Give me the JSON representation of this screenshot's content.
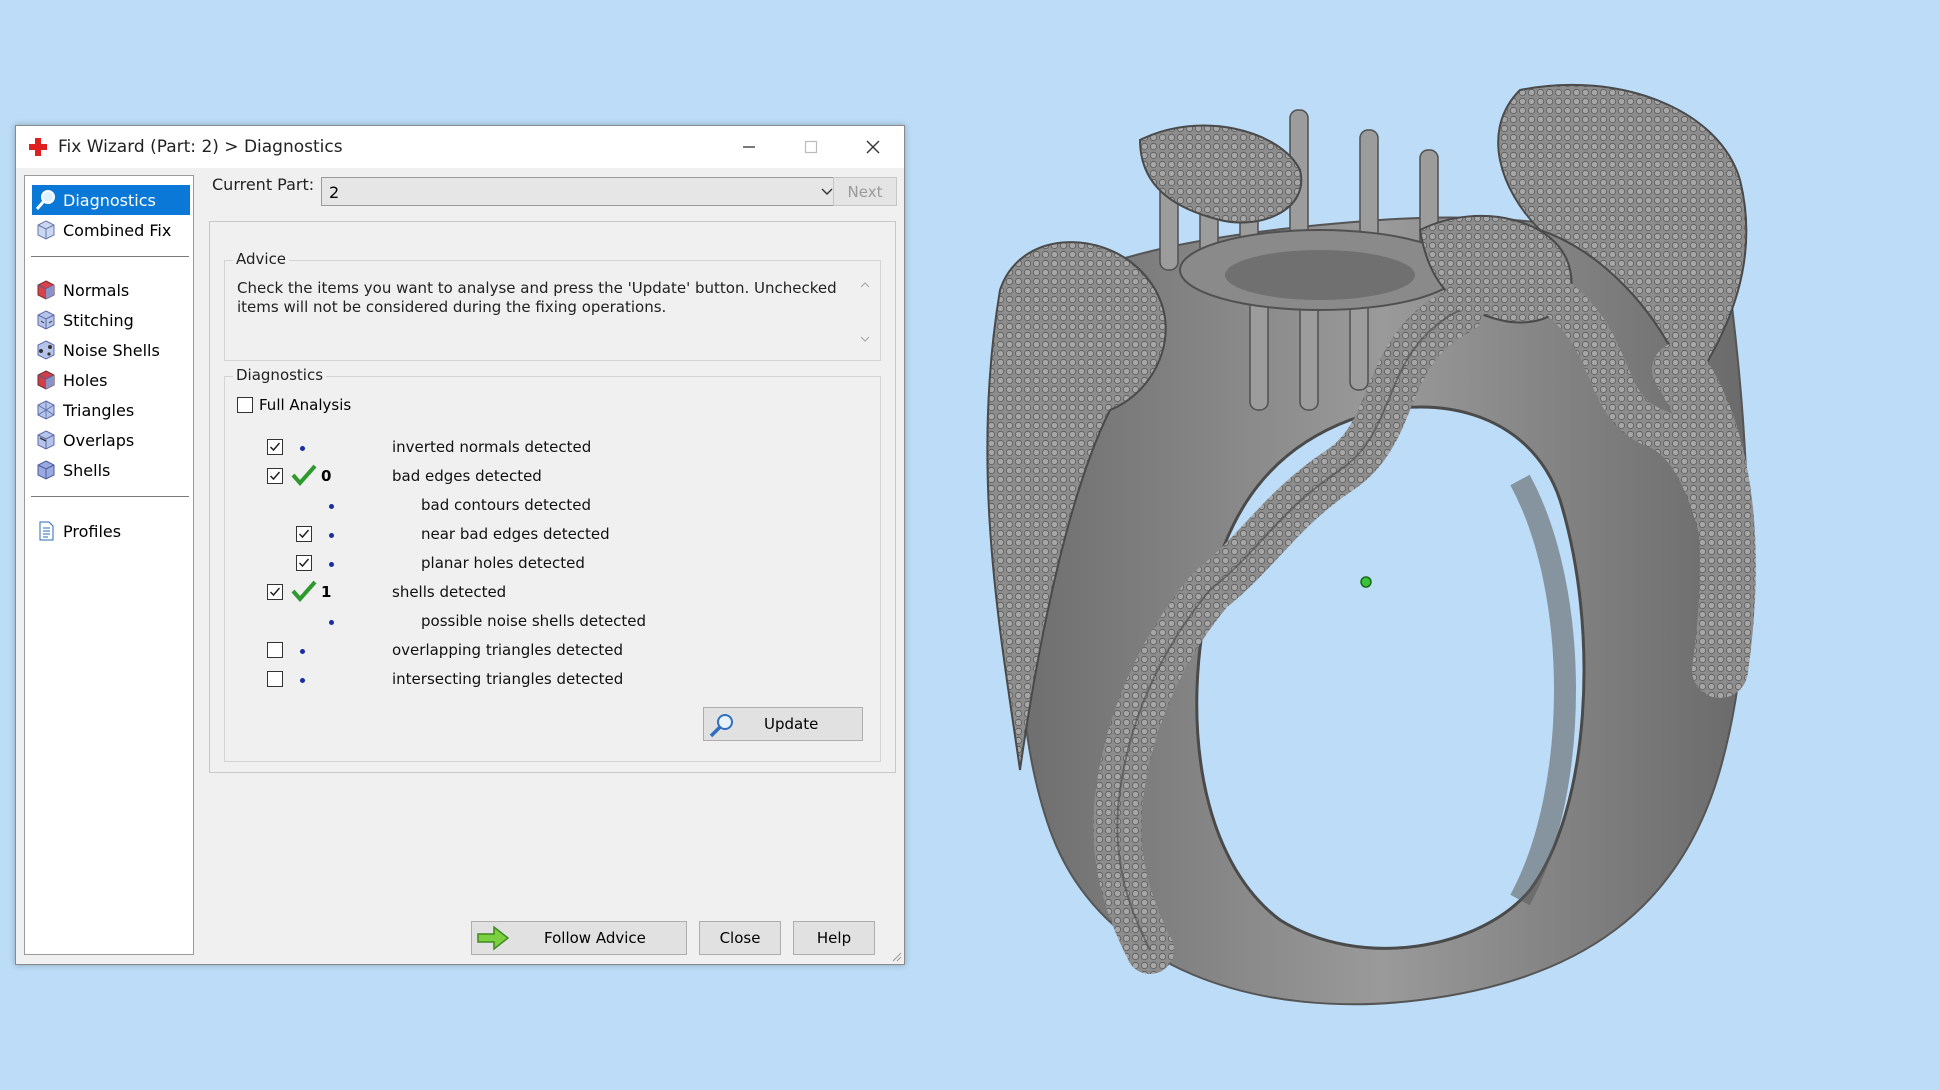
{
  "window": {
    "title": "Fix Wizard (Part: 2) > Diagnostics",
    "controls": {
      "minimize": "minimize",
      "maximize": "maximize",
      "close": "close"
    }
  },
  "nav": {
    "groups": [
      [
        {
          "label": "Diagnostics",
          "icon": "magnifier-icon",
          "active": true
        },
        {
          "label": "Combined Fix",
          "icon": "cube-icon"
        }
      ],
      [
        {
          "label": "Normals",
          "icon": "cube-red-icon"
        },
        {
          "label": "Stitching",
          "icon": "cube-stitch-icon"
        },
        {
          "label": "Noise Shells",
          "icon": "cube-noise-icon"
        },
        {
          "label": "Holes",
          "icon": "cube-holes-icon"
        },
        {
          "label": "Triangles",
          "icon": "cube-triangles-icon"
        },
        {
          "label": "Overlaps",
          "icon": "cube-overlaps-icon"
        },
        {
          "label": "Shells",
          "icon": "cube-shells-icon"
        }
      ],
      [
        {
          "label": "Profiles",
          "icon": "document-icon"
        }
      ]
    ]
  },
  "header": {
    "current_part_label": "Current Part:",
    "current_part_value": "2",
    "next_label": "Next"
  },
  "advice": {
    "title": "Advice",
    "text": "Check the items you want to analyse and press the 'Update' button. Unchecked items will not be considered during the fixing operations."
  },
  "diagnostics": {
    "title": "Diagnostics",
    "full_analysis_label": "Full Analysis",
    "full_analysis_checked": false,
    "rows": [
      {
        "label": "inverted normals detected",
        "checked": true,
        "indent": 0,
        "count": "",
        "ok": false
      },
      {
        "label": "bad edges detected",
        "checked": true,
        "indent": 0,
        "count": "0",
        "ok": true
      },
      {
        "label": "bad contours detected",
        "checked": null,
        "indent": 1,
        "count": "",
        "ok": false
      },
      {
        "label": "near bad edges detected",
        "checked": true,
        "indent": 1,
        "count": "",
        "ok": false
      },
      {
        "label": "planar holes detected",
        "checked": true,
        "indent": 1,
        "count": "",
        "ok": false
      },
      {
        "label": "shells detected",
        "checked": true,
        "indent": 0,
        "count": "1",
        "ok": true
      },
      {
        "label": "possible noise shells detected",
        "checked": null,
        "indent": 1,
        "count": "",
        "ok": false
      },
      {
        "label": "overlapping triangles detected",
        "checked": false,
        "indent": 0,
        "count": "",
        "ok": false
      },
      {
        "label": "intersecting triangles detected",
        "checked": false,
        "indent": 0,
        "count": "",
        "ok": false
      }
    ],
    "update_label": "Update"
  },
  "footer": {
    "follow_advice_label": "Follow Advice",
    "close_label": "Close",
    "help_label": "Help"
  },
  "colors": {
    "background": "#bcdcf7",
    "accent": "#0a78d7",
    "ok_tick": "#2e9a2e",
    "model": "#7f7f7f"
  }
}
